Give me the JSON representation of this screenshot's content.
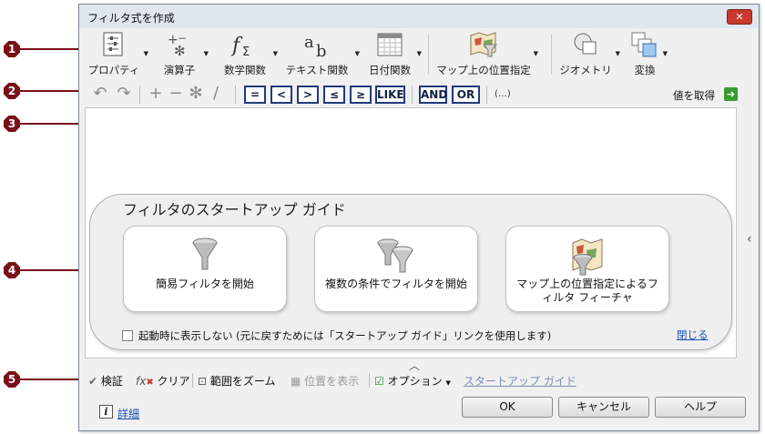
{
  "callouts": [
    "1",
    "2",
    "3",
    "4",
    "5"
  ],
  "window": {
    "title": "フィルタ式を作成",
    "close_label": "✕"
  },
  "ribbon": [
    {
      "label": "プロパティ",
      "icon": "properties-icon"
    },
    {
      "label": "演算子",
      "icon": "operators-icon"
    },
    {
      "label": "数学関数",
      "icon": "math-function-icon"
    },
    {
      "label": "テキスト関数",
      "icon": "text-function-icon"
    },
    {
      "label": "日付関数",
      "icon": "date-function-icon"
    },
    {
      "label": "マップ上の位置指定",
      "icon": "map-location-icon"
    },
    {
      "label": "ジオメトリ",
      "icon": "geometry-icon"
    },
    {
      "label": "変換",
      "icon": "transform-icon"
    }
  ],
  "operators": {
    "items": [
      "=",
      "<",
      ">",
      "≤",
      "≥",
      "LIKE",
      "AND",
      "OR"
    ],
    "ellipsis": "(…)",
    "get_value": "値を取得"
  },
  "startup_guide": {
    "title": "フィルタのスタートアップ ガイド",
    "cards": [
      {
        "label": "簡易フィルタを開始",
        "icon": "funnel-icon"
      },
      {
        "label": "複数の条件でフィルタを開始",
        "icon": "multi-funnel-icon"
      },
      {
        "label": "マップ上の位置指定によるフィルタ フィーチャ",
        "icon": "map-funnel-icon"
      }
    ],
    "checkbox_label": "起動時に表示しない (元に戻すためには「スタートアップ ガイド」リンクを使用します)",
    "checkbox_checked": false,
    "close_link": "閉じる"
  },
  "bottom_toolbar": {
    "validate": "検証",
    "clear": "クリア",
    "zoom_extent": "範囲をズーム",
    "show_location": "位置を表示",
    "options": "オプション",
    "startup_guide": "スタートアップ ガイド"
  },
  "footer": {
    "ok": "OK",
    "cancel": "キャンセル",
    "help": "ヘルプ",
    "details": "詳細"
  },
  "colors": {
    "callout": "#7a1018",
    "accent_blue": "#1f3b7a",
    "link": "#1c4fb3",
    "close_red": "#c7382d"
  }
}
